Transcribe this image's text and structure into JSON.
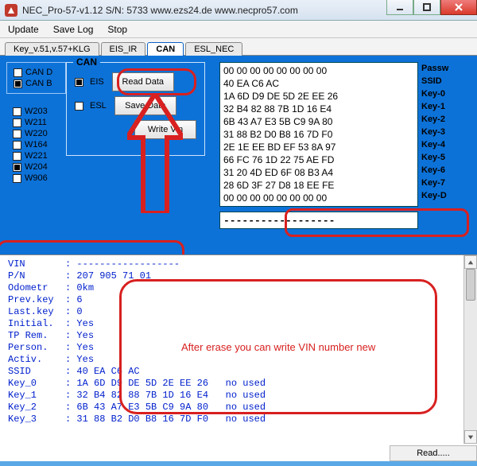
{
  "window": {
    "title": "NEC_Pro-57-v1.12   S/N:  5733    www.ezs24.de   www.necpro57.com"
  },
  "menu": {
    "update": "Update",
    "savelog": "Save Log",
    "stop": "Stop"
  },
  "tabs": [
    {
      "label": "Key_v.51,v.57+KLG"
    },
    {
      "label": "EIS_IR"
    },
    {
      "label": "CAN",
      "active": true
    },
    {
      "label": "ESL_NEC"
    }
  ],
  "canbus": {
    "can_d": "CAN D",
    "can_b": "CAN B"
  },
  "models": {
    "w203": "W203",
    "w211": "W211",
    "w220": "W220",
    "w164": "W164",
    "w221": "W221",
    "w204": "W204",
    "w906": "W906"
  },
  "can_panel": {
    "legend": "CAN",
    "eis": "EIS",
    "esl": "ESL",
    "read": "Read Data",
    "save": "Save Data",
    "write": "Write Vin"
  },
  "hex_rows": [
    "00 00 00 00 00 00 00 00",
    "40 EA C6 AC            ",
    "1A 6D D9 DE 5D 2E EE 26",
    "32 B4 82 88 7B 1D 16 E4",
    "6B 43 A7 E3 5B C9 9A 80",
    "31 88 B2 D0 B8 16 7D F0",
    "2E 1E EE BD EF 53 8A 97",
    "66 FC 76 1D 22 75 AE FD",
    "31 20 4D ED 6F 08 B3 A4",
    "28 6D 3F 27 D8 18 EE FE",
    "00 00 00 00 00 00 00 00"
  ],
  "hex_labels": [
    "Passw",
    "SSID",
    "Key-0",
    "Key-1",
    "Key-2",
    "Key-3",
    "Key-4",
    "Key-5",
    "Key-6",
    "Key-7",
    "Key-D"
  ],
  "dash_value": "------------------",
  "info_lines": [
    "VIN       : ------------------",
    "P/N       : 207 905 71 01",
    "Odometr   : 0km",
    "Prev.key  : 6",
    "Last.key  : 0",
    "Initial.  : Yes",
    "TP Rem.   : Yes",
    "Person.   : Yes",
    "Activ.    : Yes",
    "SSID      : 40 EA C6 AC",
    "Key_0     : 1A 6D D9 DE 5D 2E EE 26   no used",
    "Key_1     : 32 B4 82 88 7B 1D 16 E4   no used",
    "Key_2     : 6B 43 A7 E3 5B C9 9A 80   no used",
    "Key_3     : 31 88 B2 D0 B8 16 7D F0   no used"
  ],
  "annotation_text": "After erase you can write VIN number new",
  "status": "Read....."
}
